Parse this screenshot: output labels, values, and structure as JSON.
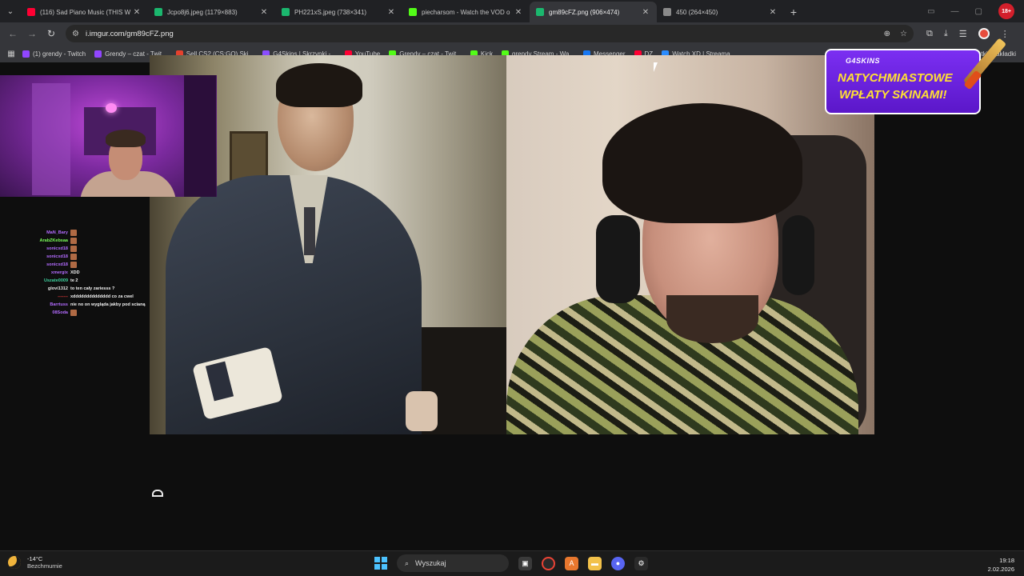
{
  "browser": {
    "tabs": [
      {
        "title": "(116) Sad Piano Music (THIS W",
        "favicon_color": "#ff0033",
        "active": false
      },
      {
        "title": "Jcpo8j6.jpeg (1179×883)",
        "favicon_color": "#1bb76e",
        "active": false
      },
      {
        "title": "PH221xS.jpeg (738×341)",
        "favicon_color": "#1bb76e",
        "active": false
      },
      {
        "title": "piecharsom - Watch the VOD o",
        "favicon_color": "#53fc18",
        "active": false
      },
      {
        "title": "gm89cFZ.png (906×474)",
        "favicon_color": "#1bb76e",
        "active": true
      },
      {
        "title": "450 (264×450)",
        "favicon_color": "#8a8a8a",
        "active": false
      }
    ],
    "new_tab_label": "+",
    "url": "i.imgur.com/gm89cFZ.png",
    "bookmarks": [
      {
        "label": "(1) grendy - Twitch",
        "favicon_color": "#9146ff"
      },
      {
        "label": "Grendy – czat - Twit...",
        "favicon_color": "#9146ff"
      },
      {
        "label": "Sell CS2 (CS:GO) Ski...",
        "favicon_color": "#e5412d"
      },
      {
        "label": "G4Skins | Skrzynki -...",
        "favicon_color": "#8a4dff"
      },
      {
        "label": "YouTube",
        "favicon_color": "#ff0033"
      },
      {
        "label": "Grendy – czat - Twit...",
        "favicon_color": "#53fc18"
      },
      {
        "label": "Kick",
        "favicon_color": "#53fc18"
      },
      {
        "label": "grendy Stream - Wa...",
        "favicon_color": "#53fc18"
      },
      {
        "label": "Messenger",
        "favicon_color": "#1877f2"
      },
      {
        "label": "DZ",
        "favicon_color": "#ff0033"
      },
      {
        "label": "Watch XD | Streama...",
        "favicon_color": "#2a8cff"
      }
    ],
    "bookmarks_right": "ystkie zakładki"
  },
  "ad": {
    "brand": "G4SKINS",
    "line1": "NATYCHMIASTOWE",
    "line2": "WPŁATY SKINAMI!"
  },
  "chat": [
    {
      "user": "MaN_Bary",
      "color": "#b36bff",
      "msg": "",
      "emote": true
    },
    {
      "user": "ArabZKebsaa",
      "color": "#7cff5a",
      "msg": "",
      "emote": true
    },
    {
      "user": "sonicxd18",
      "color": "#b36bff",
      "msg": "",
      "emote": true
    },
    {
      "user": "sonicxd18",
      "color": "#b36bff",
      "msg": "",
      "emote": true
    },
    {
      "user": "sonicxd18",
      "color": "#b36bff",
      "msg": "",
      "emote": true
    },
    {
      "user": "xmergix",
      "color": "#b36bff",
      "msg": "XDD",
      "emote": false
    },
    {
      "user": "Uszate0009",
      "color": "#3fd4a0",
      "msg": "te 2",
      "emote": false
    },
    {
      "user": "glovi1312",
      "color": "#e8e8e8",
      "msg": "to ten cały zariesss ?",
      "emote": false
    },
    {
      "user": "-------",
      "color": "#ff4040",
      "msg": "xdddddddddddddd co za cwel",
      "emote": false
    },
    {
      "user": "Barrtuss",
      "color": "#b36bff",
      "msg": "nie no on wygląda jakby pod scianą",
      "emote": false
    },
    {
      "user": "08Soda",
      "color": "#b36bff",
      "msg": "",
      "emote": true
    }
  ],
  "taskbar": {
    "temperature": "-14°C",
    "weather": "Bezchmurnie",
    "search_placeholder": "Wyszukaj",
    "time": "19:18",
    "date": "2.02.2026"
  }
}
